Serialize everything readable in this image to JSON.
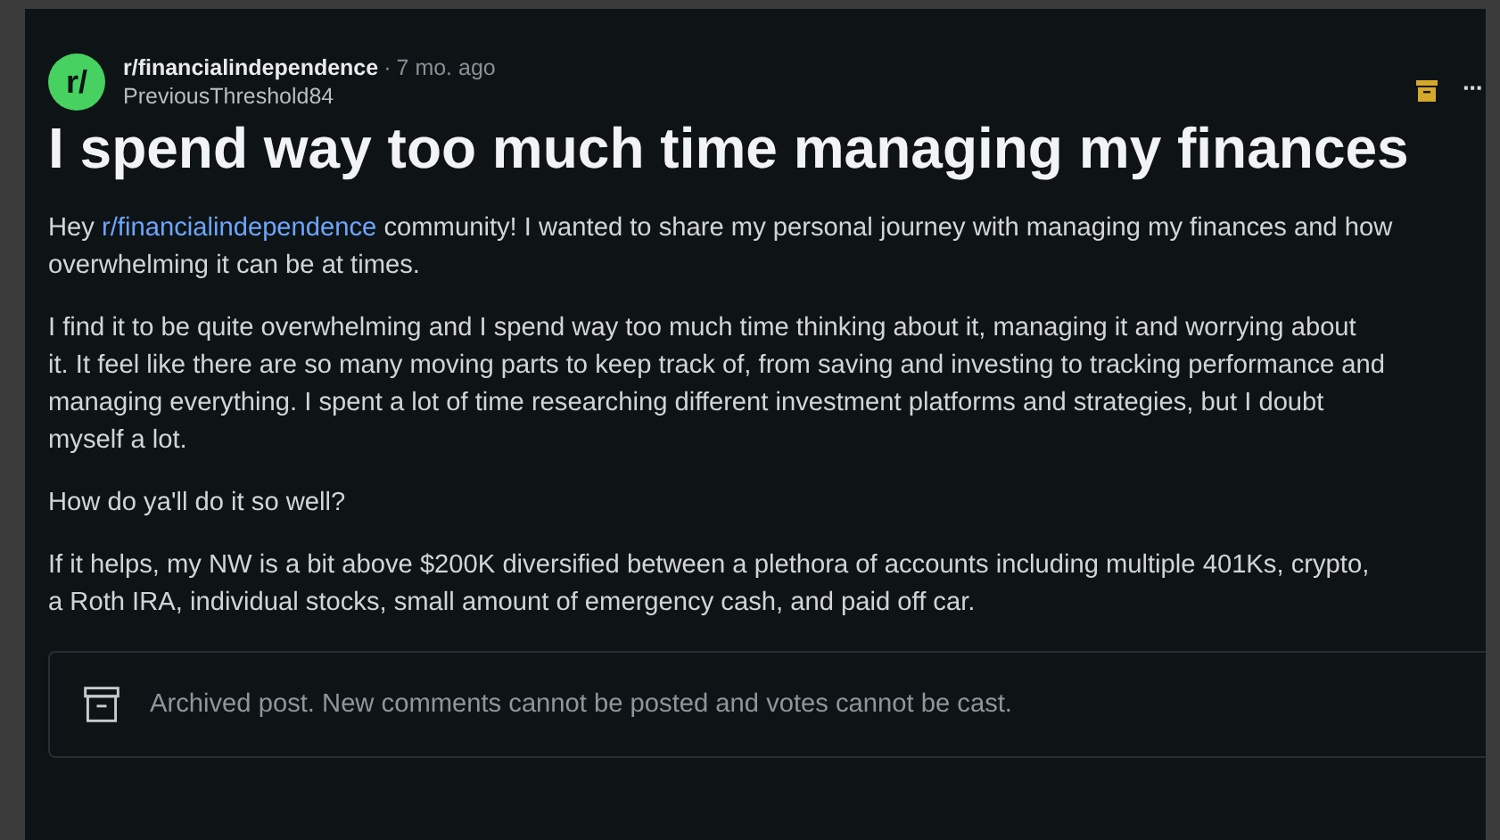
{
  "post": {
    "avatar_text": "r/",
    "subreddit": "r/financialindependence",
    "separator": "·",
    "age": "7 mo. ago",
    "author": "PreviousThreshold84",
    "more": "···",
    "title": "I spend way too much time managing my finances",
    "body": [
      {
        "before": "Hey ",
        "link": "r/financialindependence",
        "after": " community! I wanted to share my personal journey with managing my finances and how\noverwhelming it can be at times."
      },
      {
        "before": "I find it to be quite overwhelming and I spend way too much time thinking about it, managing it and worrying about\nit. It feel like there are so many moving parts to keep track of, from saving and investing to tracking performance and\nmanaging everything. I spent a lot of time researching different investment platforms and strategies, but I doubt\nmyself a lot."
      },
      {
        "before": "How do ya'll do it so well?"
      },
      {
        "before": "If it helps, my NW is a bit above $200K diversified between a plethora of accounts including multiple 401Ks, crypto,\na Roth IRA, individual stocks, small amount of emergency cash, and paid off car."
      }
    ],
    "notice": "Archived post. New comments cannot be posted and votes cannot be cast."
  }
}
